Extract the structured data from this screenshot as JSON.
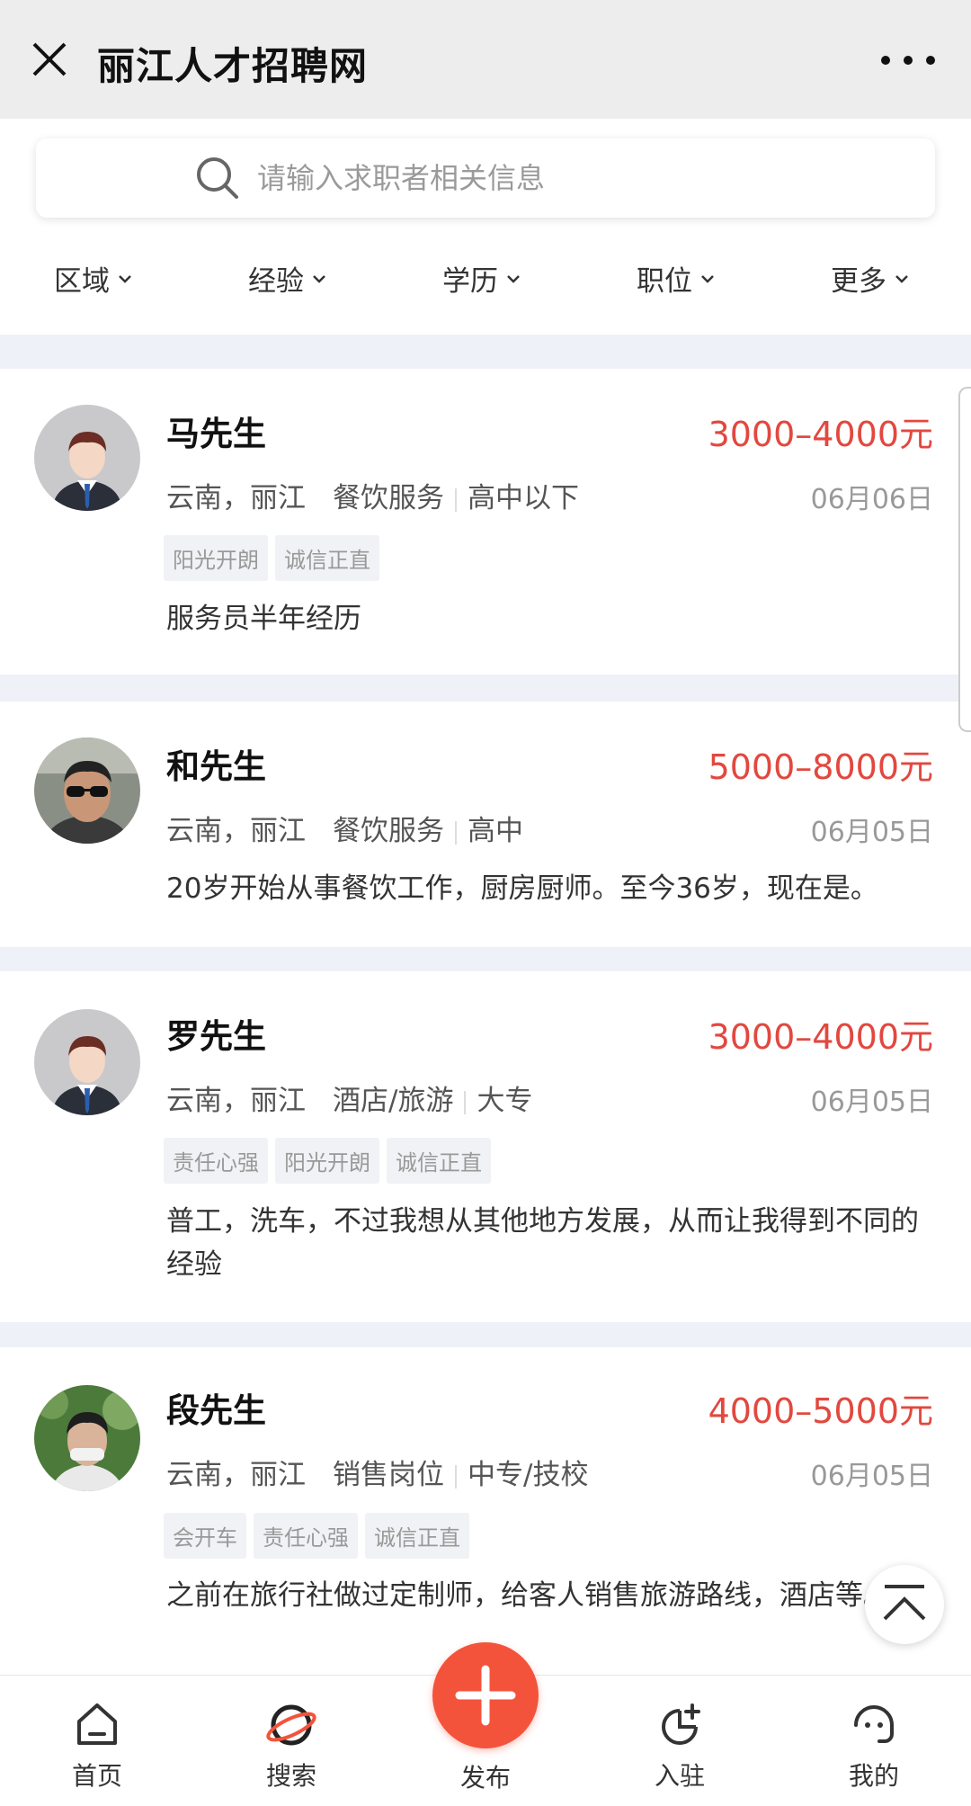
{
  "header": {
    "title": "丽江人才招聘网"
  },
  "search": {
    "placeholder": "请输入求职者相关信息"
  },
  "filters": [
    "区域",
    "经验",
    "学历",
    "职位",
    "更多"
  ],
  "candidates": [
    {
      "name": "马先生",
      "salary": "3000–4000元",
      "location": "云南，丽江",
      "industry": "餐饮服务",
      "education": "高中以下",
      "date": "06月06日",
      "tags": [
        "阳光开朗",
        "诚信正直"
      ],
      "desc": "服务员半年经历",
      "avatar": "cartoon-man-avatar"
    },
    {
      "name": "和先生",
      "salary": "5000–8000元",
      "location": "云南，丽江",
      "industry": "餐饮服务",
      "education": "高中",
      "date": "06月05日",
      "tags": [],
      "desc": "20岁开始从事餐饮工作，厨房厨师。至今36岁，现在是。",
      "avatar": "photo-avatar"
    },
    {
      "name": "罗先生",
      "salary": "3000–4000元",
      "location": "云南，丽江",
      "industry": "酒店/旅游",
      "education": "大专",
      "date": "06月05日",
      "tags": [
        "责任心强",
        "阳光开朗",
        "诚信正直"
      ],
      "desc": "普工，洗车，不过我想从其他地方发展，从而让我得到不同的经验",
      "avatar": "cartoon-man-avatar"
    },
    {
      "name": "段先生",
      "salary": "4000–5000元",
      "location": "云南，丽江",
      "industry": "销售岗位",
      "education": "中专/技校",
      "date": "06月05日",
      "tags": [
        "会开车",
        "责任心强",
        "诚信正直"
      ],
      "desc": "之前在旅行社做过定制师，给客人销售旅游路线，酒店等。",
      "avatar": "photo-avatar"
    }
  ],
  "nav": {
    "home": "首页",
    "search": "搜索",
    "publish": "发布",
    "join": "入驻",
    "mine": "我的"
  },
  "colors": {
    "accent": "#f4533b",
    "salary": "#e2483f"
  }
}
